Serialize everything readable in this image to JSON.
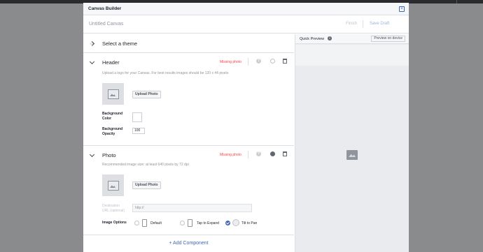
{
  "modal": {
    "title": "Canvas Builder",
    "close_glyph": "×"
  },
  "namebar": {
    "canvas_name": "Untitled Canvas",
    "finish_label": "Finish",
    "save_draft_label": "Save Draft"
  },
  "theme_section": {
    "label": "Select a theme"
  },
  "header_section": {
    "label": "Header",
    "status": "Missing photo",
    "help": "Upload a logo for your Canvas. For best results images should be 120 x 44 pixels",
    "upload_label": "Upload Photo",
    "bg_color_label_line1": "Background",
    "bg_color_label_line2": "Color",
    "bg_opacity_label_line1": "Background",
    "bg_opacity_label_line2": "Opacity",
    "bg_opacity_value": "100",
    "help_icon_glyph": "?"
  },
  "photo_section": {
    "label": "Photo",
    "status": "Missing photo",
    "help": "Recommended image size: at least 640 pixels by 72 dpi",
    "upload_label": "Upload Photo",
    "dest_label_line1": "Destination",
    "dest_label_line2": "URL (optional)",
    "url_placeholder": "http://",
    "image_options_label": "Image Options",
    "options": [
      {
        "label": "Default",
        "selected": false
      },
      {
        "label": "Tap to Expand",
        "selected": false
      },
      {
        "label": "Tilt to Pan",
        "selected": true
      }
    ],
    "help_icon_glyph": "?"
  },
  "add_component_label": "+ Add Component",
  "preview": {
    "label": "Quick Preview",
    "info_glyph": "i",
    "device_button_label": "Preview on device"
  },
  "colors": {
    "accent": "#4267b2",
    "error": "#fa3e3e",
    "backdrop": "#8a8b8d"
  }
}
